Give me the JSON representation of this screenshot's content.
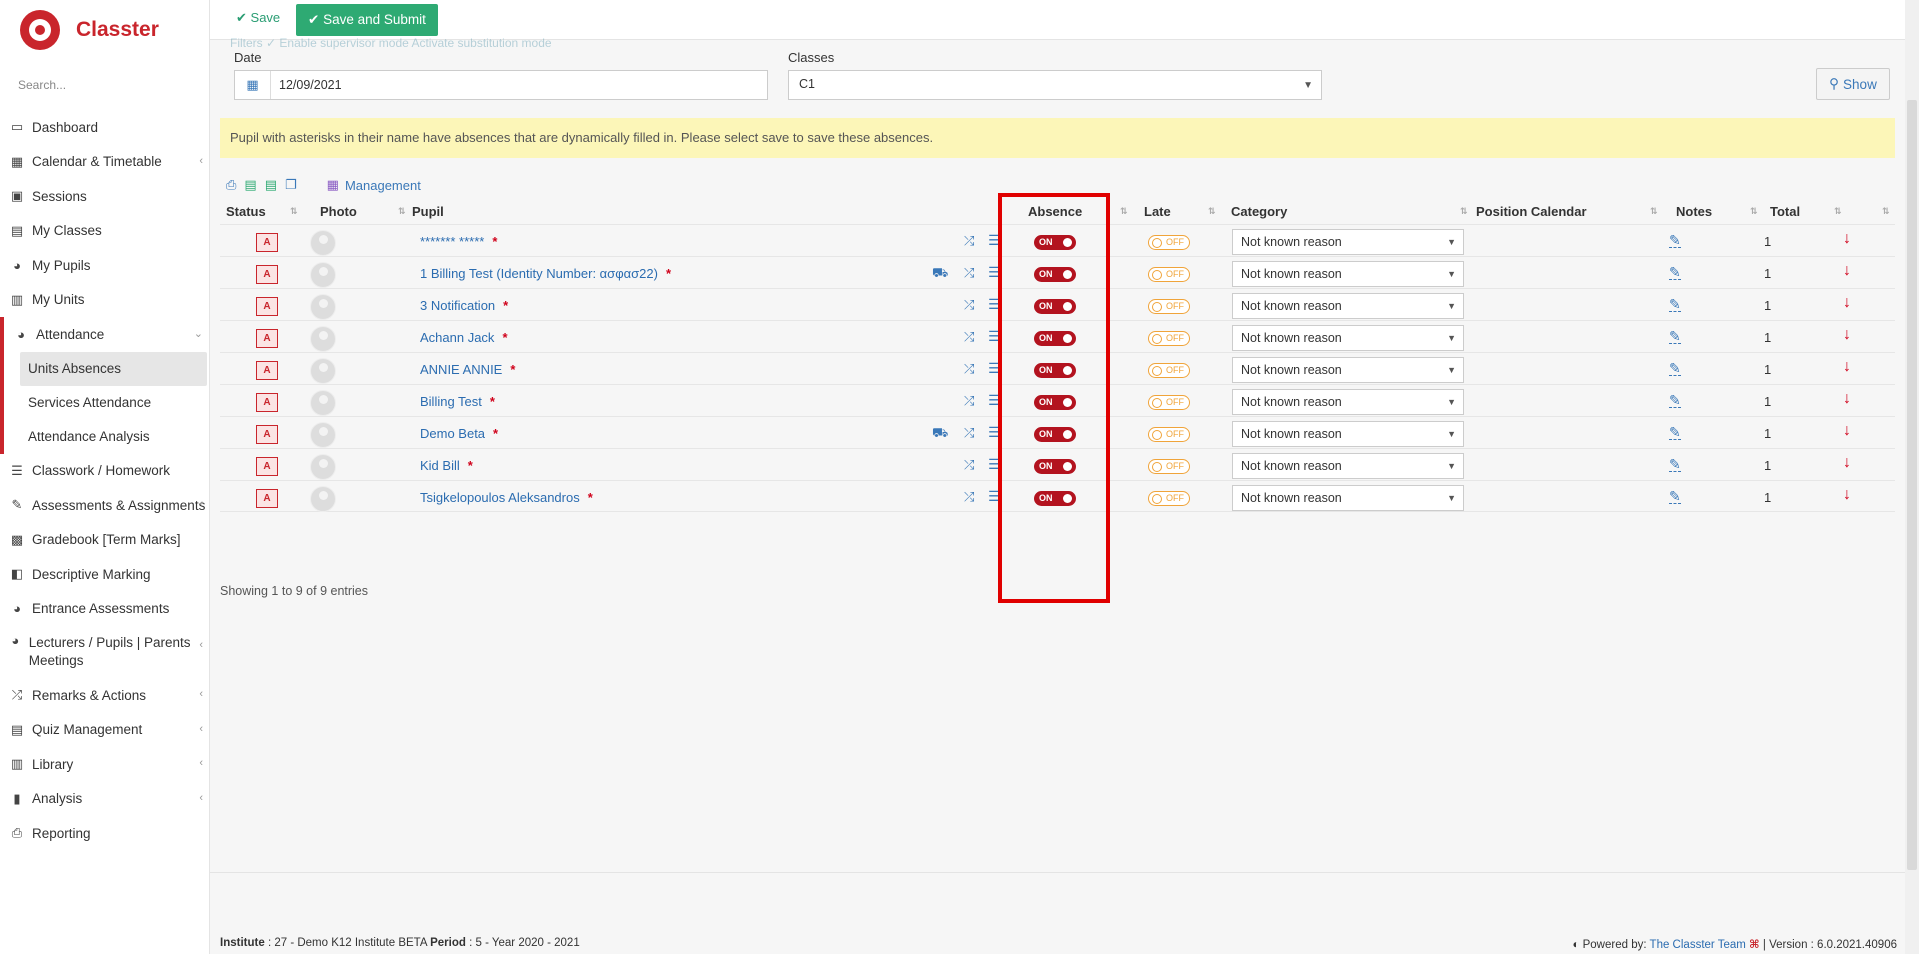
{
  "app": {
    "name": "Classter",
    "brand_color": "#c9252c"
  },
  "sidebar": {
    "search_placeholder": "Search...",
    "items": [
      {
        "label": "Dashboard",
        "icon": "monitor-icon"
      },
      {
        "label": "Calendar & Timetable",
        "icon": "calendar-icon",
        "has_children": true
      },
      {
        "label": "Sessions",
        "icon": "sessions-icon"
      },
      {
        "label": "My Classes",
        "icon": "classes-icon"
      },
      {
        "label": "My Pupils",
        "icon": "users-icon"
      },
      {
        "label": "My Units",
        "icon": "book-icon"
      },
      {
        "label": "Attendance",
        "icon": "user-check-icon",
        "expanded": true
      },
      {
        "label": "Classwork / Homework",
        "icon": "list-check-icon"
      },
      {
        "label": "Assessments & Assignments",
        "icon": "edit-icon",
        "has_children": true
      },
      {
        "label": "Gradebook [Term Marks]",
        "icon": "gradebook-icon"
      },
      {
        "label": "Descriptive Marking",
        "icon": "comment-icon"
      },
      {
        "label": "Entrance Assessments",
        "icon": "person-edit-icon"
      },
      {
        "label": "Lecturers / Pupils | Parents Meetings",
        "icon": "meeting-icon",
        "has_children": true
      },
      {
        "label": "Remarks & Actions",
        "icon": "shuffle-icon",
        "has_children": true
      },
      {
        "label": "Quiz Management",
        "icon": "quiz-icon",
        "has_children": true
      },
      {
        "label": "Library",
        "icon": "library-icon",
        "has_children": true
      },
      {
        "label": "Analysis",
        "icon": "bar-chart-icon",
        "has_children": true
      },
      {
        "label": "Reporting",
        "icon": "printer-icon"
      }
    ],
    "attendance_children": [
      {
        "label": "Units Absences",
        "active": true
      },
      {
        "label": "Services Attendance"
      },
      {
        "label": "Attendance Analysis"
      }
    ]
  },
  "toolbar": {
    "save_label": "Save",
    "submit_label": "Save and Submit"
  },
  "filters": {
    "faded_text": "Filters   ✓ Enable supervisor mode       Activate substitution mode",
    "date_label": "Date",
    "date_value": "12/09/2021",
    "classes_label": "Classes",
    "class_value": "C1",
    "show_label": "Show"
  },
  "notice": "Pupil with asterisks in their name have absences that are dynamically filled in. Please select save to save these absences.",
  "tools": {
    "management_label": "Management"
  },
  "table": {
    "columns": [
      "Status",
      "Photo",
      "Pupil",
      "Absence",
      "Late",
      "Category",
      "Position Calendar",
      "Notes",
      "Total"
    ],
    "rows": [
      {
        "status": "A",
        "pupil": "******* *****",
        "bus": false,
        "absence": "ON",
        "late": "OFF",
        "category": "Not known reason",
        "total": "1"
      },
      {
        "status": "A",
        "pupil": "1 Billing Test (Identity Number: ασφασ22)",
        "bus": true,
        "absence": "ON",
        "late": "OFF",
        "category": "Not known reason",
        "total": "1"
      },
      {
        "status": "A",
        "pupil": "3 Notification",
        "bus": false,
        "absence": "ON",
        "late": "OFF",
        "category": "Not known reason",
        "total": "1"
      },
      {
        "status": "A",
        "pupil": "Achann Jack",
        "bus": false,
        "absence": "ON",
        "late": "OFF",
        "category": "Not known reason",
        "total": "1"
      },
      {
        "status": "A",
        "pupil": "ANNIE ANNIE",
        "bus": false,
        "absence": "ON",
        "late": "OFF",
        "category": "Not known reason",
        "total": "1"
      },
      {
        "status": "A",
        "pupil": "Billing Test",
        "bus": false,
        "absence": "ON",
        "late": "OFF",
        "category": "Not known reason",
        "total": "1"
      },
      {
        "status": "A",
        "pupil": "Demo Beta",
        "bus": true,
        "absence": "ON",
        "late": "OFF",
        "category": "Not known reason",
        "total": "1"
      },
      {
        "status": "A",
        "pupil": "Kid Bill",
        "bus": false,
        "absence": "ON",
        "late": "OFF",
        "category": "Not known reason",
        "total": "1"
      },
      {
        "status": "A",
        "pupil": "Tsigkelopoulos Aleksandros",
        "bus": false,
        "absence": "ON",
        "late": "OFF",
        "category": "Not known reason",
        "total": "1"
      }
    ],
    "info": "Showing 1 to 9 of 9 entries"
  },
  "footer": {
    "institute_label": "Institute",
    "institute_value": ": 27 - Demo K12 Institute BETA",
    "period_label": "Period",
    "period_value": ": 5 - Year 2020 - 2021",
    "powered_label": "Powered by:",
    "powered_link": "The Classter Team",
    "version": "| Version : 6.0.2021.40906"
  },
  "colors": {
    "accent": "#2eaa73",
    "absence_on": "#b3131f",
    "late_off": "#f0a43a",
    "notice_bg": "#fcf6b8",
    "link": "#2b6cb0"
  }
}
